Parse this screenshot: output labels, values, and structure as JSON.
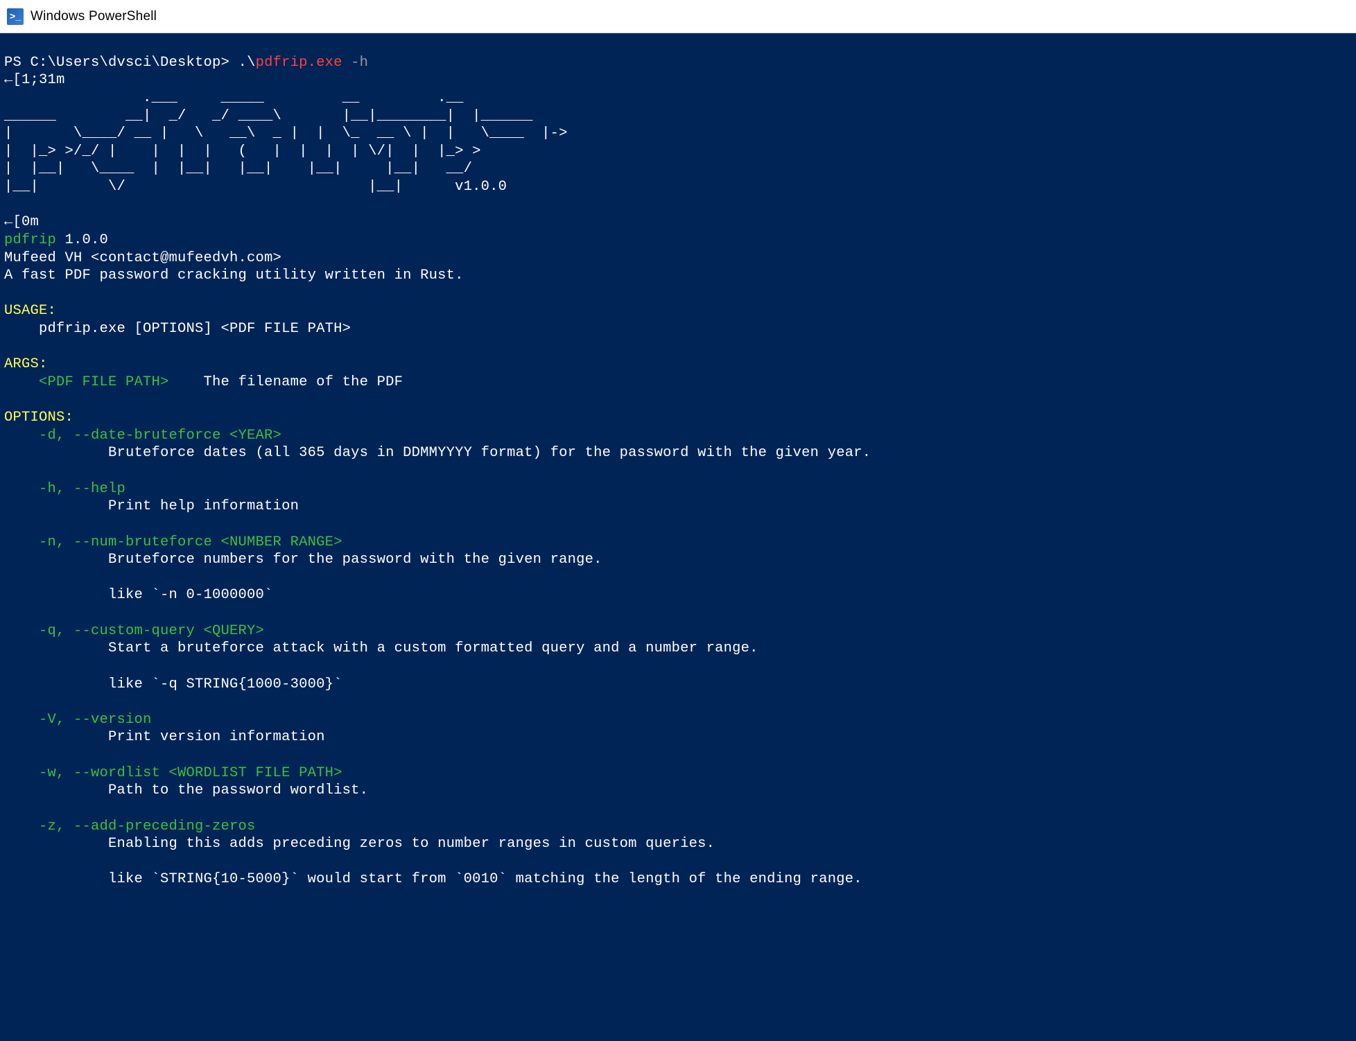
{
  "titlebar": {
    "text": "Windows PowerShell"
  },
  "prompt": {
    "path": "PS C:\\Users\\dvsci\\Desktop> ",
    "cmd_prefix": ".\\",
    "cmd_file": "pdfrip.exe",
    "cmd_arg": " -h",
    "ansi_start": "←[1;31m",
    "ansi_end": "←[0m"
  },
  "ascii_art": "                .___     _____         __         .__                 \n______        __|  _/   _/ ____\\       |__|________|  |______          \n|       \\____/ __ |   \\   __\\  _ |  |  \\_  __ \\ |  |   \\____  |->         \n|  |_> >/_/ |    |  |  |   (   |  |  |  | \\/|  |  |_> >        \n|  |__|   \\____  |  |__|   |__|    |__|     |__|   __/         \n|__|        \\/                            |__|      v1.0.0",
  "app": {
    "name": "pdfrip",
    "version": " 1.0.0",
    "author": "Mufeed VH <contact@mufeedvh.com>",
    "desc": "A fast PDF password cracking utility written in Rust."
  },
  "headers": {
    "usage": "USAGE:",
    "usage_line": "    pdfrip.exe [OPTIONS] <PDF FILE PATH>",
    "args": "ARGS:",
    "options": "OPTIONS:"
  },
  "args_section": {
    "name": "    <PDF FILE PATH>",
    "desc": "    The filename of the PDF"
  },
  "options": [
    {
      "flag": "    -d, --date-bruteforce <YEAR>",
      "desc": "            Bruteforce dates (all 365 days in DDMMYYYY format) for the password with the given year."
    },
    {
      "flag": "    -h, --help",
      "desc": "            Print help information"
    },
    {
      "flag": "    -n, --num-bruteforce <NUMBER RANGE>",
      "desc": "            Bruteforce numbers for the password with the given range.",
      "extra": "            like `-n 0-1000000`"
    },
    {
      "flag": "    -q, --custom-query <QUERY>",
      "desc": "            Start a bruteforce attack with a custom formatted query and a number range.",
      "extra": "            like `-q STRING{1000-3000}`"
    },
    {
      "flag": "    -V, --version",
      "desc": "            Print version information"
    },
    {
      "flag": "    -w, --wordlist <WORDLIST FILE PATH>",
      "desc": "            Path to the password wordlist."
    },
    {
      "flag": "    -z, --add-preceding-zeros",
      "desc": "            Enabling this adds preceding zeros to number ranges in custom queries.",
      "extra": "            like `STRING{10-5000}` would start from `0010` matching the length of the ending range."
    }
  ]
}
